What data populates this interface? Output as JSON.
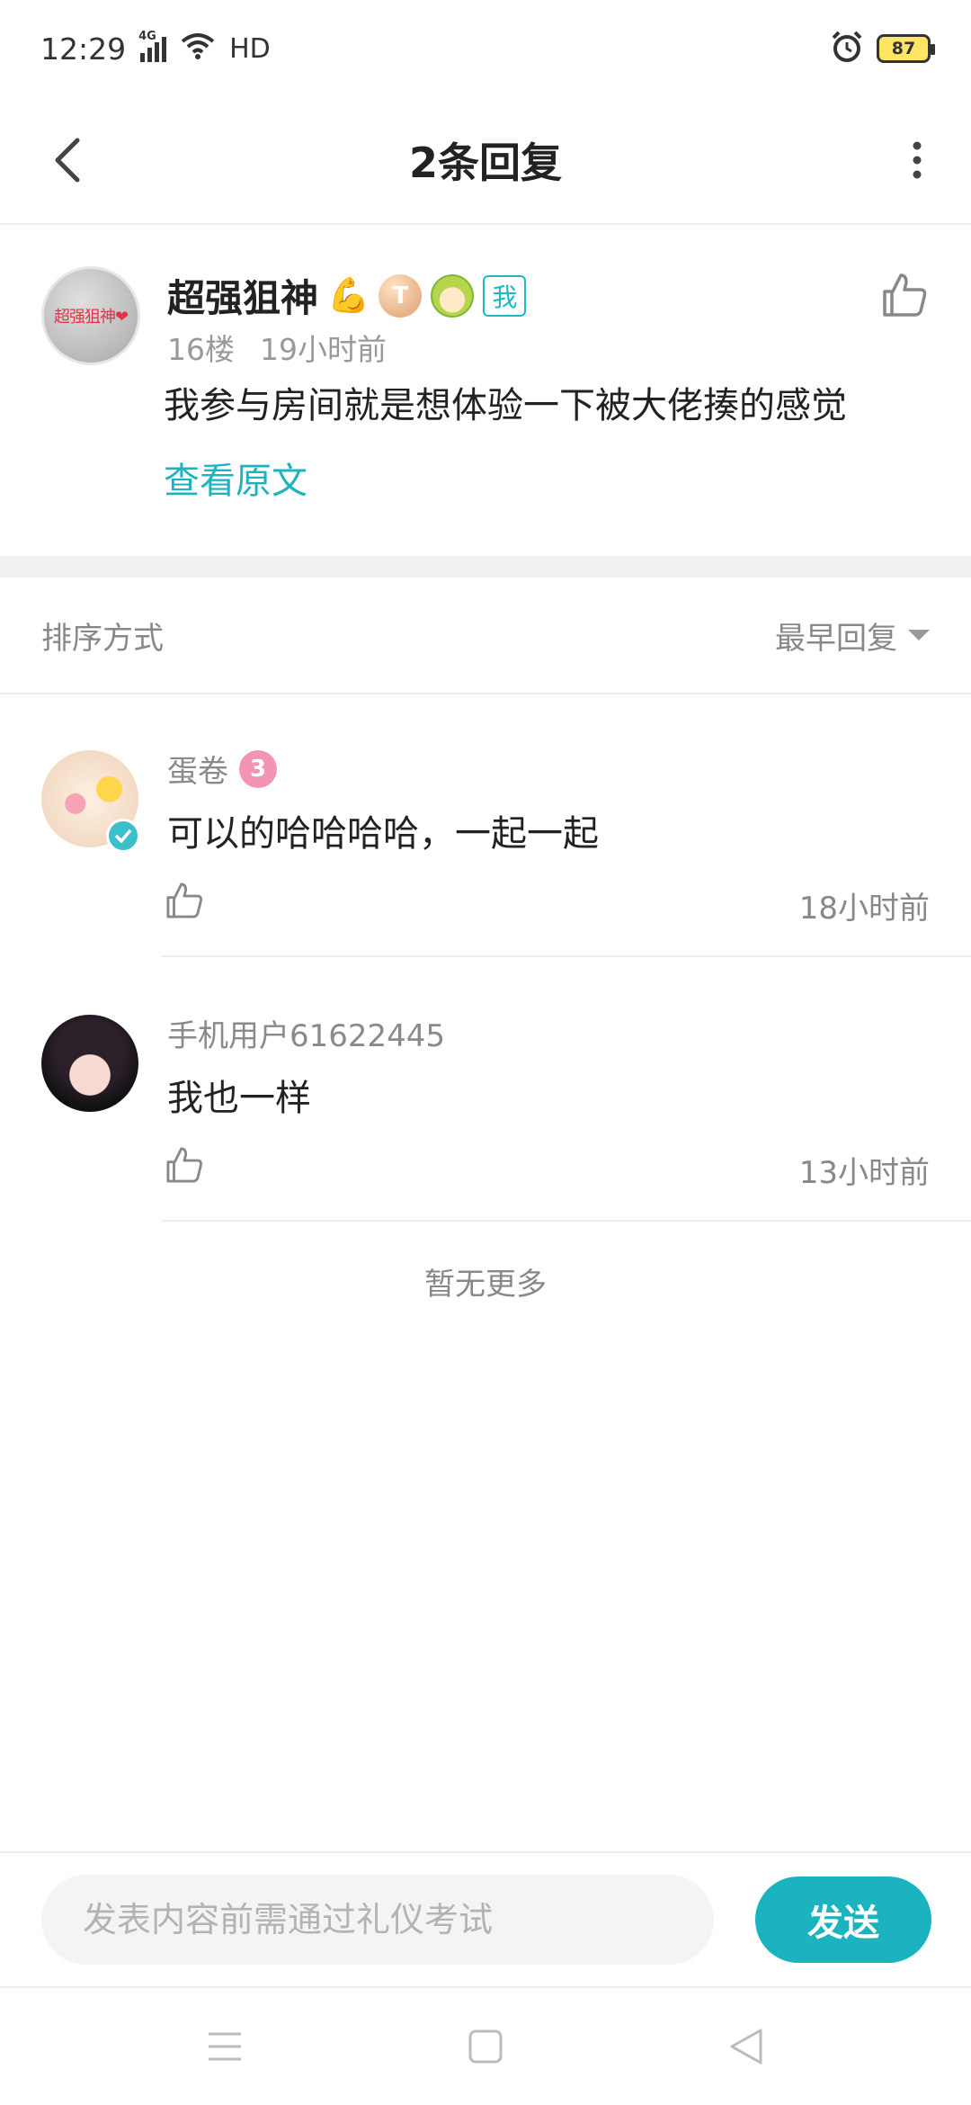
{
  "status_bar": {
    "time": "12:29",
    "network": "4G",
    "hd": "HD",
    "battery": "87",
    "icons": [
      "signal-icon",
      "wifi-icon",
      "alarm-icon",
      "battery-icon"
    ]
  },
  "header": {
    "title": "2条回复",
    "icons": [
      "back-arrow-icon",
      "more-dots-icon"
    ]
  },
  "post": {
    "avatar_text": "超强狙神❤",
    "username": "超强狙神",
    "name_emoji": "💪",
    "level_badge": "T",
    "me_tag": "我",
    "floor": "16楼",
    "time": "19小时前",
    "content": "我参与房间就是想体验一下被大佬揍的感觉",
    "view_original": "查看原文"
  },
  "sort": {
    "label": "排序方式",
    "selected": "最早回复"
  },
  "replies": [
    {
      "username": "蛋卷",
      "level": "3",
      "verified": true,
      "content": "可以的哈哈哈哈，一起一起",
      "time": "18小时前"
    },
    {
      "username": "手机用户61622445",
      "content": "我也一样",
      "time": "13小时前"
    }
  ],
  "no_more": "暂无更多",
  "composer": {
    "placeholder": "发表内容前需通过礼仪考试",
    "send_label": "发送"
  },
  "colors": {
    "accent": "#1cb3c0",
    "battery_fill": "#ffe564"
  }
}
